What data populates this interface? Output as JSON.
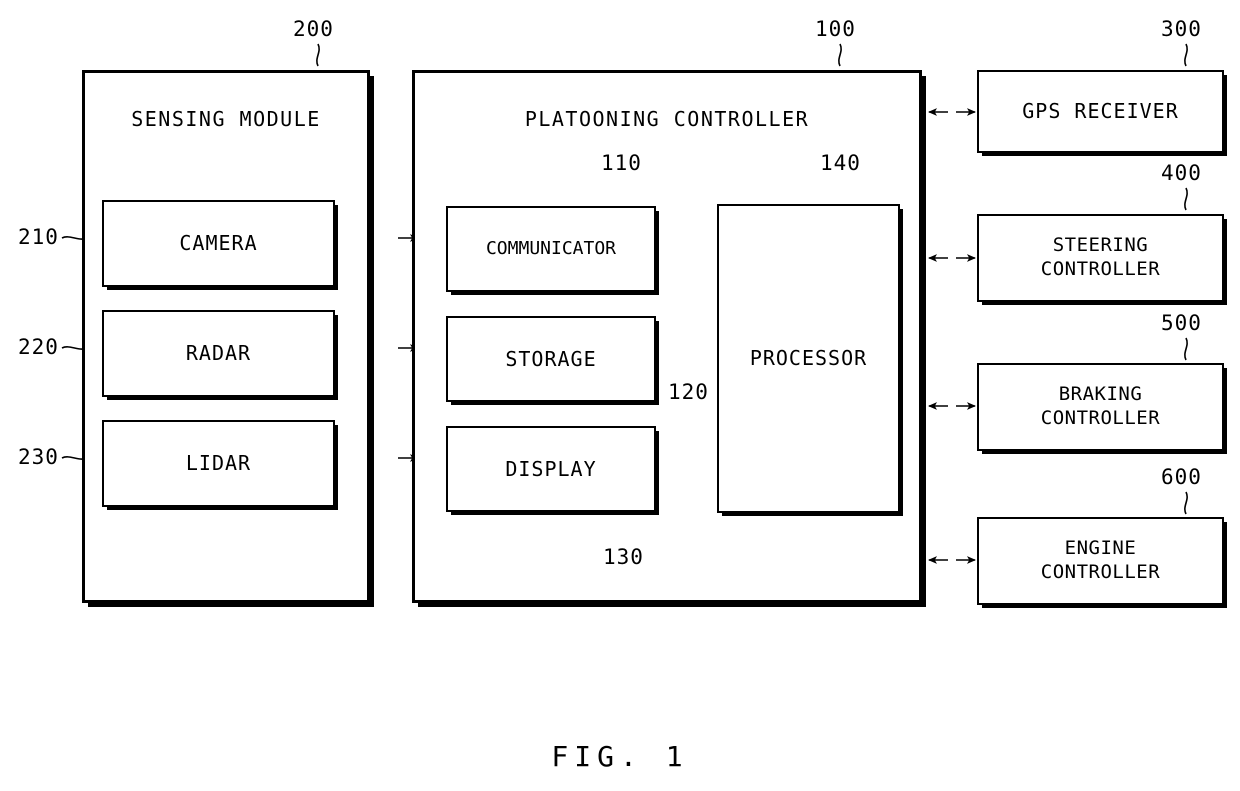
{
  "figure": {
    "caption": "FIG. 1"
  },
  "outer_blocks": [
    {
      "id": "sensing-module",
      "title": "SENSING MODULE",
      "ref": "200"
    },
    {
      "id": "platooning-controller",
      "title": "PLATOONING CONTROLLER",
      "ref": "100"
    }
  ],
  "sensing_module": {
    "title": "SENSING MODULE",
    "ref": "200",
    "items": [
      {
        "label": "CAMERA",
        "ref": "210"
      },
      {
        "label": "RADAR",
        "ref": "220"
      },
      {
        "label": "LIDAR",
        "ref": "230"
      }
    ]
  },
  "platooning_controller": {
    "title": "PLATOONING CONTROLLER",
    "ref": "100",
    "items": [
      {
        "label": "COMMUNICATOR",
        "ref": "110"
      },
      {
        "label": "STORAGE",
        "ref": "120"
      },
      {
        "label": "DISPLAY",
        "ref": "130"
      }
    ],
    "processor": {
      "label": "PROCESSOR",
      "ref": "140"
    }
  },
  "external_blocks": [
    {
      "line1": "GPS RECEIVER",
      "line2": "",
      "ref": "300"
    },
    {
      "line1": "STEERING",
      "line2": "CONTROLLER",
      "ref": "400"
    },
    {
      "line1": "BRAKING",
      "line2": "CONTROLLER",
      "ref": "500"
    },
    {
      "line1": "ENGINE",
      "line2": "CONTROLLER",
      "ref": "600"
    }
  ],
  "colors": {
    "stroke": "#000000",
    "background": "#ffffff"
  }
}
